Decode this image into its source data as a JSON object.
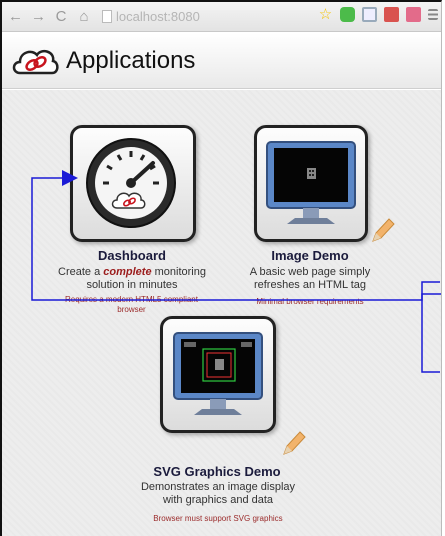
{
  "browser": {
    "url": "localhost:8080"
  },
  "header": {
    "title": "Applications"
  },
  "apps": [
    {
      "title": "Dashboard",
      "desc_pre": "Create a ",
      "desc_emph": "complete",
      "desc_post": " monitoring solution in minutes",
      "requirement": "Requires a modern HTML5 compliant browser"
    },
    {
      "title": "Image Demo",
      "desc": "A basic web page simply refreshes an HTML  tag",
      "requirement": "Minimal browser requirements"
    },
    {
      "title": "SVG Graphics Demo",
      "desc": "Demonstrates an image display with graphics and data",
      "requirement": "Browser must support SVG graphics"
    }
  ],
  "colors": {
    "app_title": "#1b1b3c",
    "requirement_text": "#9b2b2b",
    "emphasis": "#9b1c1c",
    "annotation_line": "#1a1ad6"
  },
  "icons": [
    "back-icon",
    "forward-icon",
    "reload-icon",
    "home-icon",
    "page-icon",
    "star-icon",
    "menu-icon",
    "speedometer-icon",
    "monitor-icon",
    "pencil-icon",
    "cloud-logo-icon"
  ]
}
